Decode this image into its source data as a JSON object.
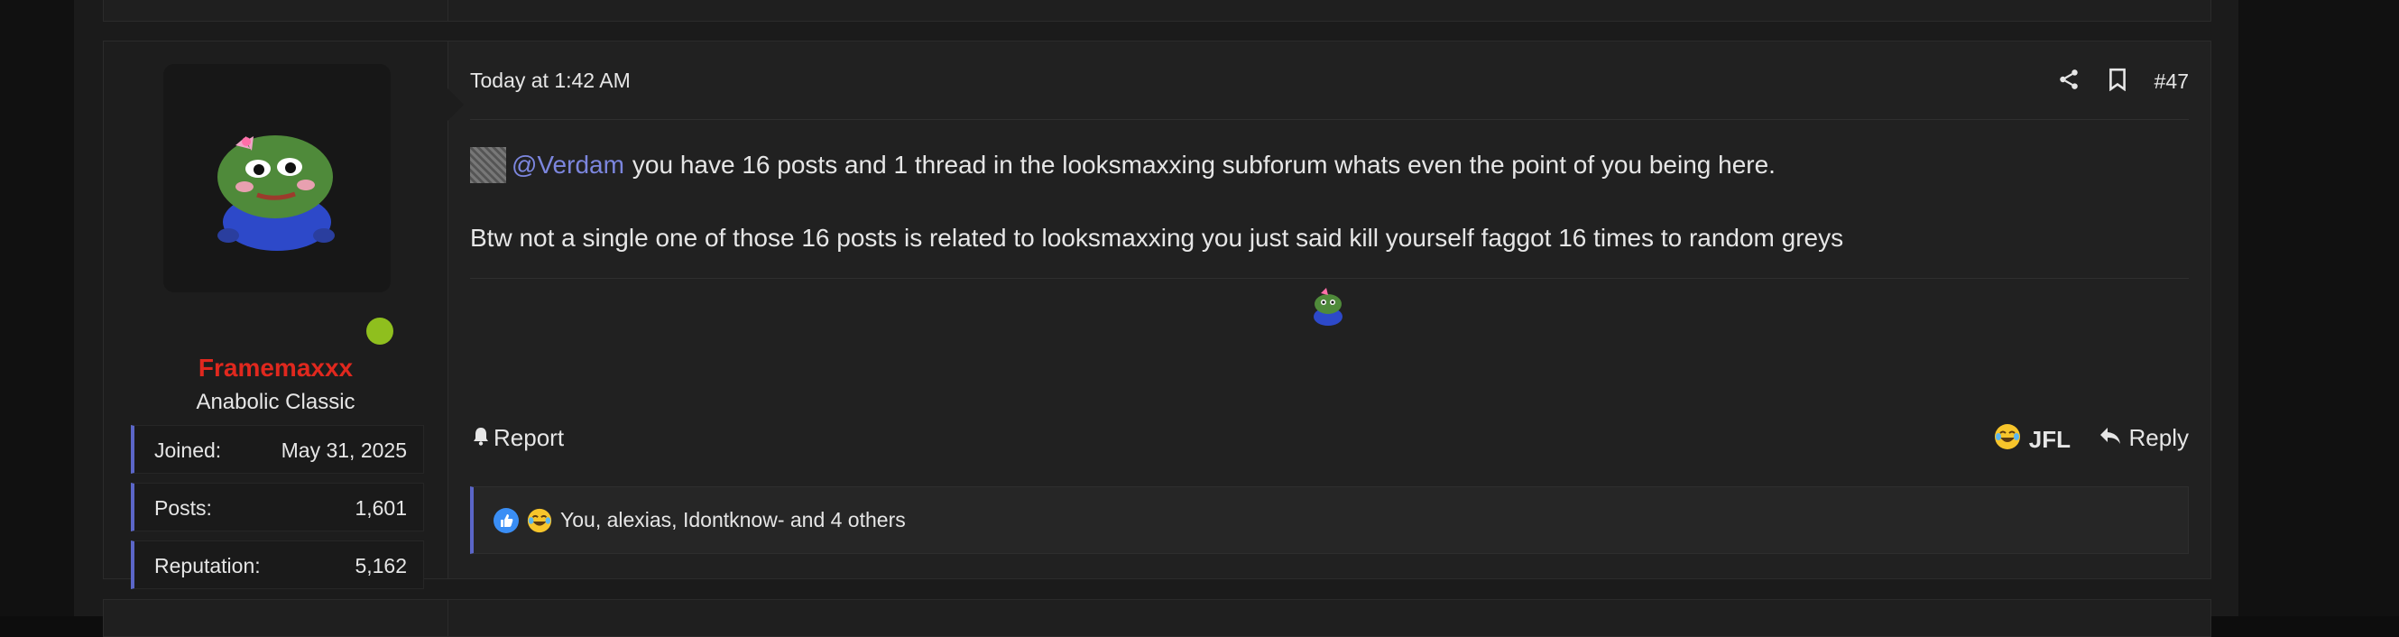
{
  "post": {
    "timestamp": "Today at 1:42 AM",
    "post_number": "#47",
    "mention": "@Verdam",
    "line1_rest": "you have 16 posts and 1 thread in the looksmaxxing subforum whats even the point of you being here.",
    "line2": "Btw not a single one of those 16 posts is related to looksmaxxing you just said kill yourself faggot 16 times to random greys",
    "report_label": "Report",
    "reaction_label": "JFL",
    "reply_label": "Reply",
    "reactions_summary": "You, alexias, Idontknow- and 4 others"
  },
  "user": {
    "name": "Framemaxxx",
    "title": "Anabolic Classic",
    "stats": [
      {
        "key": "Joined:",
        "value": "May 31, 2025"
      },
      {
        "key": "Posts:",
        "value": "1,601"
      },
      {
        "key": "Reputation:",
        "value": "5,162"
      }
    ]
  },
  "icons": [
    "share-icon",
    "bookmark-icon",
    "bell-icon",
    "laughing-emoji-icon",
    "reply-icon",
    "like-icon"
  ],
  "colors": {
    "mention": "#7c86de",
    "username": "#e0281e",
    "online": "#8fbf1e",
    "accent": "#5b66c8"
  }
}
